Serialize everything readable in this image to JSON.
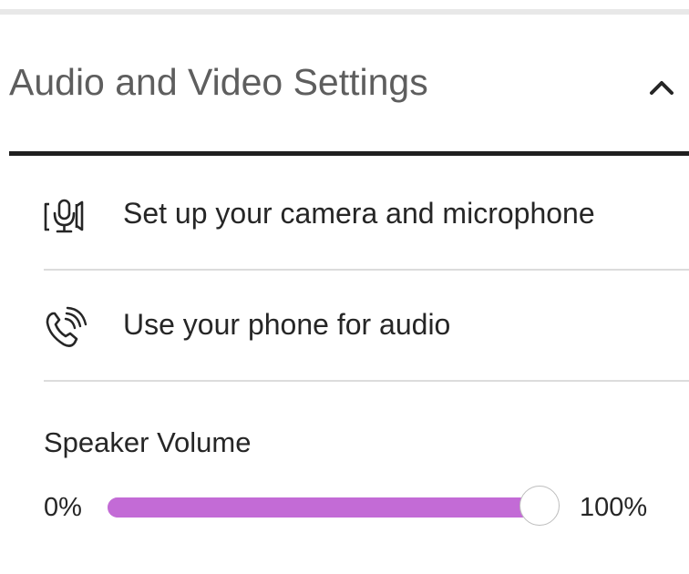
{
  "section": {
    "title": "Audio and Video Settings",
    "expanded": true,
    "toggle_icon": "chevron-up-icon"
  },
  "options": [
    {
      "icon": "camera-microphone-icon",
      "label": "Set up your camera and microphone"
    },
    {
      "icon": "phone-audio-icon",
      "label": "Use your phone for audio"
    }
  ],
  "speaker_volume": {
    "title": "Speaker Volume",
    "min_label": "0%",
    "max_label": "100%",
    "value_percent": 100
  },
  "colors": {
    "slider_fill": "#c36bd6",
    "header_rule": "#1f1f1f",
    "title_text": "#5e5e5e"
  }
}
